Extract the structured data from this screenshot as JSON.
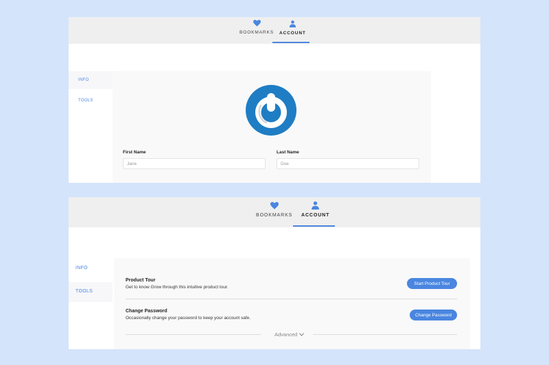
{
  "panel_top": {
    "tabs": [
      {
        "label": "BOOKMARKS",
        "icon": "heart-icon"
      },
      {
        "label": "ACCOUNT",
        "icon": "user-icon",
        "active": true
      }
    ],
    "sidebar": [
      {
        "label": "INFO",
        "active": true
      },
      {
        "label": "TOOLS",
        "active": false
      }
    ],
    "form": {
      "first_name_label": "First Name",
      "first_name_placeholder": "Jane",
      "last_name_label": "Last Name",
      "last_name_placeholder": "Doe"
    }
  },
  "panel_bottom": {
    "tabs": [
      {
        "label": "BOOKMARKS",
        "icon": "heart-icon"
      },
      {
        "label": "ACCOUNT",
        "icon": "user-icon",
        "active": true
      }
    ],
    "sidebar": [
      {
        "label": "INFO",
        "active": false
      },
      {
        "label": "TOOLS",
        "active": true
      }
    ],
    "tools": [
      {
        "title": "Product Tour",
        "description": "Get to know Grow through this intuitive product tour.",
        "button": "Start Product Tour"
      },
      {
        "title": "Change Password",
        "description": "Occasionally change your password to keep your account safe.",
        "button": "Change Password"
      }
    ],
    "advanced_label": "Advanced"
  },
  "colors": {
    "accent": "#4a86e0",
    "logo_blue": "#1f7dc4",
    "background": "#d4e4fb"
  }
}
